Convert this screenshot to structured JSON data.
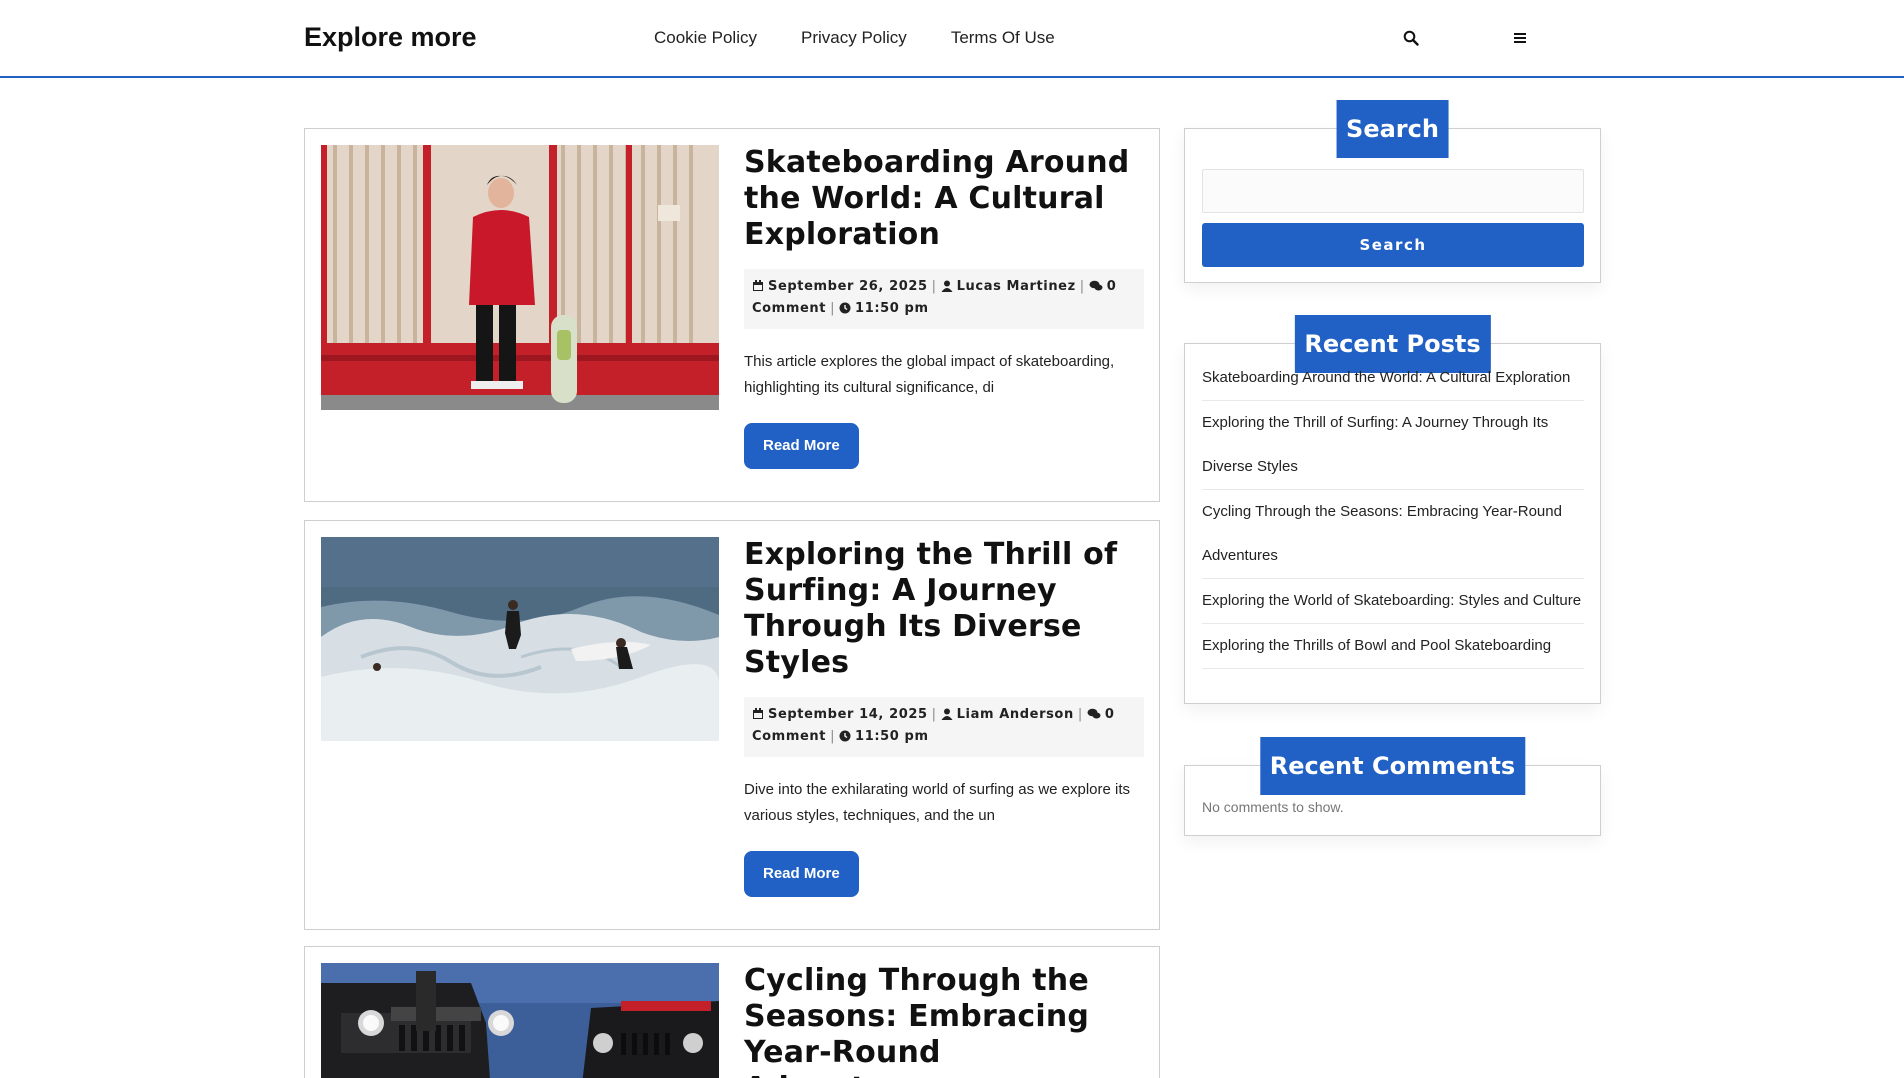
{
  "header": {
    "site_title": "Explore more",
    "nav": [
      "Cookie Policy",
      "Privacy Policy",
      "Terms Of Use"
    ],
    "icons": [
      "search-icon",
      "menu-icon"
    ]
  },
  "posts": [
    {
      "title": "Skateboarding Around the World: A Cultural Exploration",
      "date": "September 26, 2025",
      "author": "Lucas Martinez",
      "comments": "0",
      "comment_word": "Comment",
      "time": "11:50 pm",
      "excerpt": "This article explores the global impact of skateboarding, highlighting its cultural significance, di",
      "button": "Read More"
    },
    {
      "title": "Exploring the Thrill of Surfing: A Journey Through Its Diverse Styles",
      "date": "September 14, 2025",
      "author": "Liam Anderson",
      "comments": "0",
      "comment_word": "Comment",
      "time": "11:50 pm",
      "excerpt": "Dive into the exhilarating world of surfing as we explore its various styles, techniques, and the un",
      "button": "Read More"
    },
    {
      "title": "Cycling Through the Seasons: Embracing Year-Round Adventures"
    }
  ],
  "sidebar": {
    "search": {
      "title": "Search",
      "button": "Search",
      "placeholder": ""
    },
    "recent_posts": {
      "title": "Recent Posts",
      "items": [
        "Skateboarding Around the World: A Cultural Exploration",
        "Exploring the Thrill of Surfing: A Journey Through Its Diverse Styles",
        "Cycling Through the Seasons: Embracing Year-Round Adventures",
        "Exploring the World of Skateboarding: Styles and Culture",
        "Exploring the Thrills of Bowl and Pool Skateboarding"
      ]
    },
    "recent_comments": {
      "title": "Recent Comments",
      "empty_text": "No comments to show."
    }
  },
  "colors": {
    "accent": "#2160c4",
    "text": "#111111",
    "border": "#cfcfcf"
  }
}
